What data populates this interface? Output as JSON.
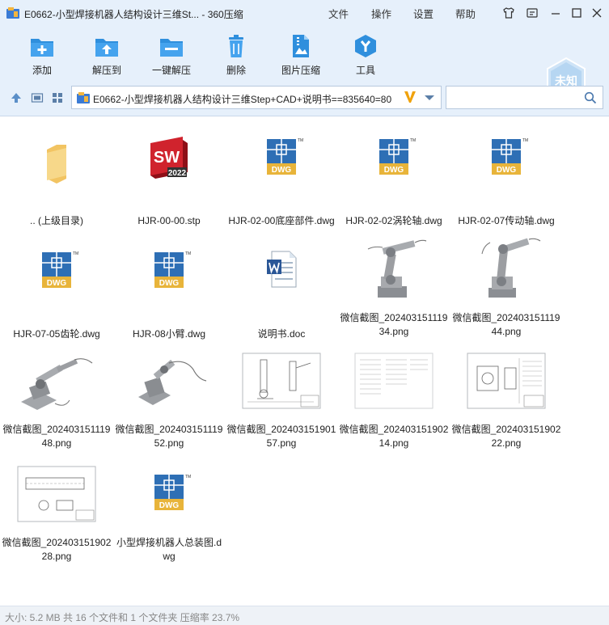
{
  "window": {
    "title": "E0662-小型焊接机器人结构设计三维St... - 360压缩",
    "menu": [
      "文件",
      "操作",
      "设置",
      "帮助"
    ]
  },
  "toolbar": {
    "buttons": [
      "添加",
      "解压到",
      "一键解压",
      "删除",
      "图片压缩",
      "工具"
    ],
    "badge": "未知"
  },
  "address": {
    "path": "E0662-小型焊接机器人结构设计三维Step+CAD+说明书==835640=80",
    "search_placeholder": ""
  },
  "icons": {
    "dwg_label": "DWG",
    "sw_label": "SW",
    "sw_year": "2022"
  },
  "files": [
    {
      "name": ".. (上级目录)",
      "type": "folder"
    },
    {
      "name": "HJR-00-00.stp",
      "type": "sw"
    },
    {
      "name": "HJR-02-00底座部件.dwg",
      "type": "dwg"
    },
    {
      "name": "HJR-02-02涡轮轴.dwg",
      "type": "dwg"
    },
    {
      "name": "HJR-02-07传动轴.dwg",
      "type": "dwg"
    },
    {
      "name": "HJR-07-05齿轮.dwg",
      "type": "dwg"
    },
    {
      "name": "HJR-08小臂.dwg",
      "type": "dwg"
    },
    {
      "name": "说明书.doc",
      "type": "doc"
    },
    {
      "name": "微信截图_20240315111934.png",
      "type": "robot1"
    },
    {
      "name": "微信截图_20240315111944.png",
      "type": "robot2"
    },
    {
      "name": "微信截图_20240315111948.png",
      "type": "robot3"
    },
    {
      "name": "微信截图_20240315111952.png",
      "type": "robot4"
    },
    {
      "name": "微信截图_20240315190157.png",
      "type": "drawing1"
    },
    {
      "name": "微信截图_20240315190214.png",
      "type": "drawing2"
    },
    {
      "name": "微信截图_20240315190222.png",
      "type": "drawing3"
    },
    {
      "name": "微信截图_20240315190228.png",
      "type": "drawing4"
    },
    {
      "name": "小型焊接机器人总装图.dwg",
      "type": "dwg"
    }
  ],
  "status": "大小: 5.2 MB 共 16 个文件和 1 个文件夹 压缩率 23.7%",
  "colors": {
    "accent": "#2f8fdd",
    "dwg_blue": "#2e6fb5",
    "dwg_gold": "#e8b43a",
    "sw_red": "#c8202a"
  }
}
